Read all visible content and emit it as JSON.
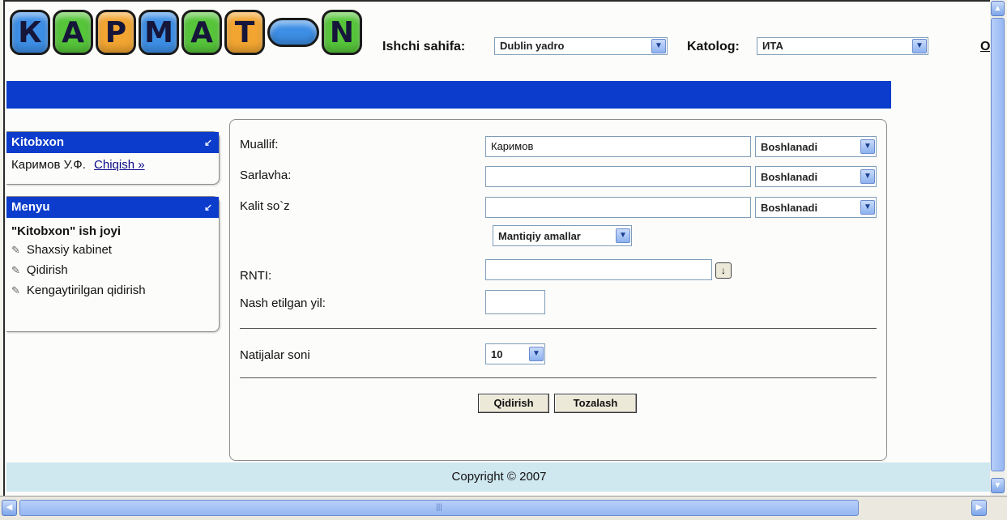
{
  "logo": {
    "letters": [
      "К",
      "А",
      "Р",
      "М",
      "А",
      "Т",
      "",
      "N"
    ]
  },
  "header": {
    "ishchi_label": "Ishchi sahifa:",
    "ishchi_value": "Dublin yadro",
    "katolog_label": "Katolog:",
    "katolog_value": "ИТА",
    "lang": "O`zbe"
  },
  "kitobxon": {
    "title": "Kitobxon",
    "user": "Каримов У.Ф.",
    "logout": "Chiqish »"
  },
  "menyu": {
    "title": "Menyu",
    "section": "\"Kitobxon\" ish joyi",
    "items": [
      "Shaxsiy kabinet",
      "Qidirish",
      "Kengaytirilgan qidirish"
    ]
  },
  "form": {
    "muallif_label": "Muallif:",
    "muallif_value": "Каримов",
    "sarlavha_label": "Sarlavha:",
    "kalit_label": "Kalit so`z",
    "match_option": "Boshlanadi",
    "mantiqiy": "Mantiqiy amallar",
    "rnti_label": "RNTI:",
    "yil_label": "Nash etilgan yil:",
    "natija_label": "Natijalar soni",
    "natija_value": "10",
    "search_btn": "Qidirish",
    "clear_btn": "Tozalash"
  },
  "footer": {
    "copyright": "Copyright © 2007"
  },
  "colors": {
    "accent": "#0b3ccc",
    "footer": "#cfe7ef"
  }
}
